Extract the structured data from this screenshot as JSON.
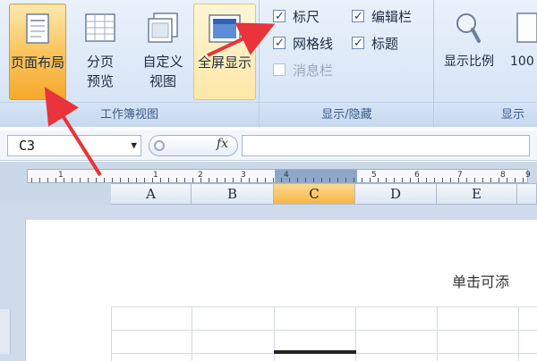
{
  "ribbon": {
    "group_workbook_views": {
      "label": "工作簿视图",
      "buttons": [
        {
          "label_lines": [
            "页面布局"
          ],
          "active": true
        },
        {
          "label_lines": [
            "分页",
            "预览"
          ],
          "active": false
        },
        {
          "label_lines": [
            "自定义",
            "视图"
          ],
          "active": false
        },
        {
          "label_lines": [
            "全屏显示"
          ],
          "active": false
        }
      ]
    },
    "group_show_hide": {
      "label": "显示/隐藏",
      "checkboxes": [
        {
          "label": "标尺",
          "checked": true,
          "enabled": true
        },
        {
          "label": "编辑栏",
          "checked": true,
          "enabled": true
        },
        {
          "label": "网格线",
          "checked": true,
          "enabled": true
        },
        {
          "label": "标题",
          "checked": true,
          "enabled": true
        },
        {
          "label": "消息栏",
          "checked": false,
          "enabled": false
        }
      ]
    },
    "group_zoom": {
      "label": "显示",
      "buttons": [
        {
          "label": "显示比例"
        },
        {
          "label": "100"
        }
      ]
    }
  },
  "formula_bar": {
    "name_box": "C3",
    "fx_label": "fx",
    "formula_value": ""
  },
  "ruler": {
    "numbers": [
      "1",
      "1",
      "2",
      "3",
      "4",
      "5",
      "6",
      "7",
      "8",
      "9"
    ]
  },
  "columns": [
    {
      "label": "A",
      "selected": false
    },
    {
      "label": "B",
      "selected": false
    },
    {
      "label": "C",
      "selected": true
    },
    {
      "label": "D",
      "selected": false
    },
    {
      "label": "E",
      "selected": false
    }
  ],
  "page": {
    "header_hint": "单击可添"
  },
  "colors": {
    "accent_arrow": "#e8343a",
    "active_button": "#f6a92c"
  }
}
